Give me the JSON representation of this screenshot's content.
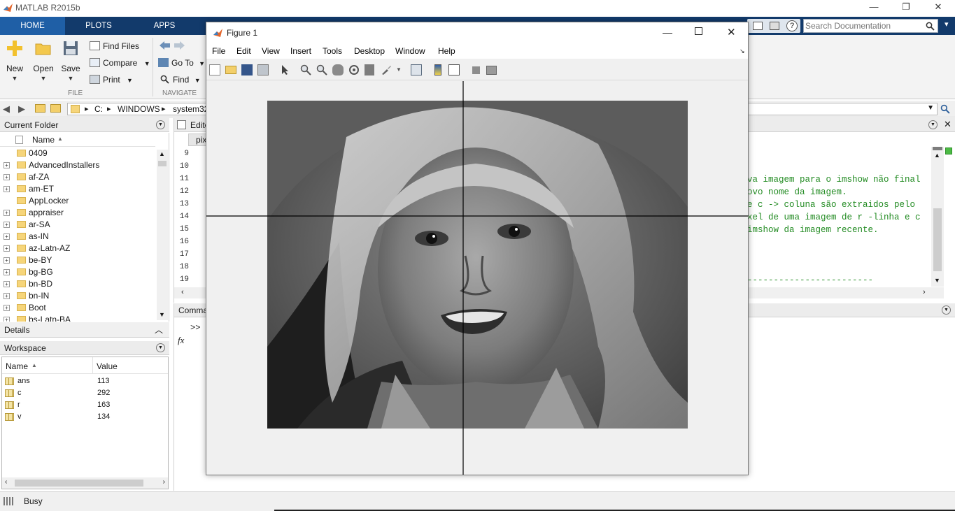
{
  "app": {
    "title": "MATLAB R2015b"
  },
  "window_controls": {
    "minimize": "—",
    "restore": "❐",
    "close": "✕"
  },
  "ribbon": {
    "tabs": [
      {
        "label": "HOME"
      },
      {
        "label": "PLOTS"
      },
      {
        "label": "APPS"
      }
    ],
    "file_group": {
      "new_label": "New",
      "open_label": "Open",
      "save_label": "Save",
      "find_files_label": "Find Files",
      "compare_label": "Compare",
      "print_label": "Print",
      "group_label": "FILE"
    },
    "navigate_group": {
      "go_to_label": "Go To",
      "find_label": "Find",
      "group_label": "NAVIGATE"
    }
  },
  "search": {
    "placeholder": "Search Documentation"
  },
  "address": {
    "path": [
      "C:",
      "WINDOWS",
      "system32"
    ]
  },
  "current_folder": {
    "title": "Current Folder",
    "column_header": "Name",
    "items": [
      {
        "name": "0409",
        "expandable": false
      },
      {
        "name": "AdvancedInstallers",
        "expandable": true
      },
      {
        "name": "af-ZA",
        "expandable": true
      },
      {
        "name": "am-ET",
        "expandable": true
      },
      {
        "name": "AppLocker",
        "expandable": false
      },
      {
        "name": "appraiser",
        "expandable": true
      },
      {
        "name": "ar-SA",
        "expandable": true
      },
      {
        "name": "as-IN",
        "expandable": true
      },
      {
        "name": "az-Latn-AZ",
        "expandable": true
      },
      {
        "name": "be-BY",
        "expandable": true
      },
      {
        "name": "bg-BG",
        "expandable": true
      },
      {
        "name": "bn-BD",
        "expandable": true
      },
      {
        "name": "bn-IN",
        "expandable": true
      },
      {
        "name": "Boot",
        "expandable": true
      },
      {
        "name": "bs-Latn-BA",
        "expandable": true
      }
    ]
  },
  "details": {
    "title": "Details"
  },
  "workspace": {
    "title": "Workspace",
    "headers": {
      "name": "Name",
      "value": "Value"
    },
    "variables": [
      {
        "name": "ans",
        "value": "113"
      },
      {
        "name": "c",
        "value": "292"
      },
      {
        "name": "r",
        "value": "163"
      },
      {
        "name": "v",
        "value": "134"
      }
    ]
  },
  "editor": {
    "title": "Edito",
    "tab": "pix",
    "line_numbers": [
      "9",
      "10",
      "11",
      "12",
      "13",
      "14",
      "15",
      "16",
      "17",
      "18",
      "19"
    ],
    "code_lines": [
      "va imagem para o imshow não final",
      "ovo nome da imagem.",
      "e c -> coluna são extraidos pelo",
      "xel de uma imagem de r -linha e c",
      "imshow da imagem recente.",
      "------------------------"
    ]
  },
  "command_window": {
    "title": "Comma",
    "prompt": ">>",
    "fx": "fx"
  },
  "figure": {
    "title": "Figure 1",
    "menu": [
      "File",
      "Edit",
      "View",
      "Insert",
      "Tools",
      "Desktop",
      "Window",
      "Help"
    ]
  },
  "status": {
    "text": "Busy"
  }
}
